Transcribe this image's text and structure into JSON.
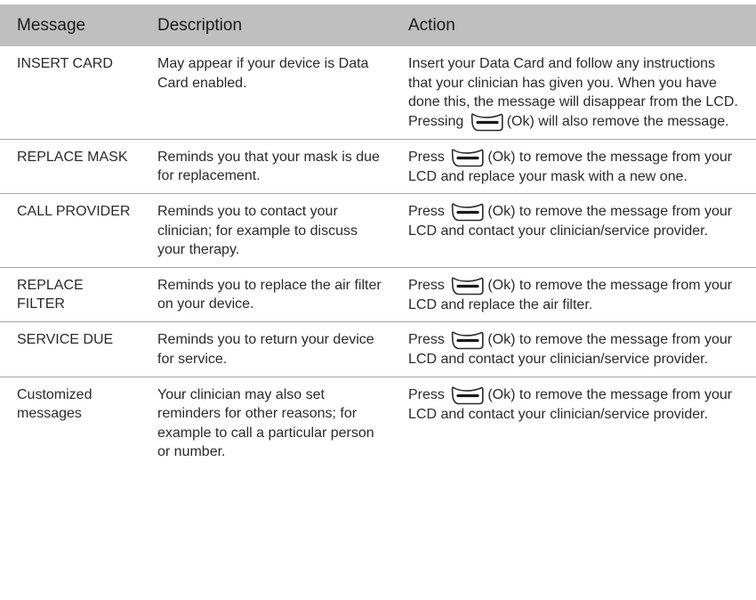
{
  "top_fragment": "",
  "table": {
    "headers": [
      "Message",
      "Description",
      "Action"
    ],
    "rows": [
      {
        "message": "INSERT CARD",
        "description": "May appear if your device is Data Card enabled.",
        "action_pre": "Insert your Data Card and follow any instructions that your clinician has given you. When you have done this, the message will disappear from the LCD. Pressing",
        "action_button": "(Ok)",
        "action_post": "will also remove the message."
      },
      {
        "message": "REPLACE MASK",
        "description": "Reminds you that your mask is due for replacement.",
        "action_pre": "Press",
        "action_button": "(Ok)",
        "action_post": "to remove the message from your LCD and replace your mask with a new one."
      },
      {
        "message": "CALL PROVIDER",
        "description": "Reminds you to contact your clinician; for example to discuss your therapy.",
        "action_pre": "Press",
        "action_button": "(Ok)",
        "action_post": "to remove the message from your LCD and contact your clinician/service provider."
      },
      {
        "message": "REPLACE FILTER",
        "description": "Reminds you to replace the air filter on your device.",
        "action_pre": "Press",
        "action_button": "(Ok)",
        "action_post": "to remove the message from your LCD and replace the air filter."
      },
      {
        "message": "SERVICE DUE",
        "description": "Reminds you to return your device for service.",
        "action_pre": "Press",
        "action_button": "(Ok)",
        "action_post": "to remove the message from your LCD and contact your clinician/service provider."
      },
      {
        "message": "Customized messages",
        "description": "Your clinician may also set reminders for other reasons; for example to call a particular person or number.",
        "action_pre": "Press",
        "action_button": "(Ok)",
        "action_post": "to remove the message from your LCD and contact your clinician/service provider."
      }
    ]
  },
  "icons": {
    "ok_button": "ok-key-icon"
  }
}
